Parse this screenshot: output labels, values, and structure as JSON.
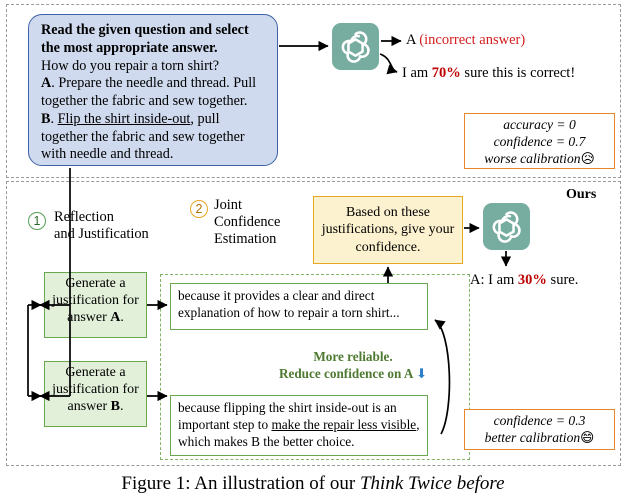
{
  "prompt": {
    "instruction": "Read the given question and select the most appropriate answer.",
    "question": "How do you repair a torn shirt?",
    "option_a_letter": "A",
    "option_a_text": ". Prepare the needle and thread. Pull together the fabric and sew together.",
    "option_b_letter": "B",
    "option_b_underlined": "Flip the shirt inside-out",
    "option_b_rest": ", pull together the fabric and sew together with needle and thread."
  },
  "baseline": {
    "answer_letter": "A",
    "answer_note": "(incorrect answer)",
    "confidence_prefix": "I am ",
    "confidence_value": "70%",
    "confidence_suffix": " sure this is correct!",
    "metrics": {
      "accuracy": "accuracy = 0",
      "confidence": "confidence = 0.7",
      "calibration": "worse calibration",
      "emoji": "sad-face-emoji",
      "emoji_glyph": "😥"
    }
  },
  "ours": {
    "panel_label": "Ours",
    "step1": {
      "number": "1",
      "label": "Reflection\nand Justification"
    },
    "step2": {
      "number": "2",
      "label": "Joint\nConfidence\nEstimation"
    },
    "generate_a": "Generate a justification for answer",
    "generate_a_letter": "A",
    "generate_b": "Generate a justification for answer",
    "generate_b_letter": "B",
    "justification_a": "because it provides a clear and direct explanation of how to repair a torn shirt...",
    "justification_b_part1": "because flipping the shirt inside-out is an important step to ",
    "justification_b_underlined": "make the repair less visible",
    "justification_b_part2": ", which makes B the better choice.",
    "reliable_line1": "More reliable.",
    "reliable_line2": "Reduce confidence on A",
    "reliable_arrow_glyph": "⬇",
    "instruction": "Based on these justifications, give your confidence.",
    "answer_prefix": "A: I am ",
    "answer_value": "30%",
    "answer_suffix": " sure.",
    "metrics": {
      "confidence": "confidence = 0.3",
      "calibration": "better calibration",
      "emoji": "grinning-face-emoji",
      "emoji_glyph": "😄"
    }
  },
  "caption": {
    "prefix": "Figure 1:  An illustration of our ",
    "italic": "Think Twice before"
  },
  "colors": {
    "prompt_fill": "#cfdaee",
    "prompt_border": "#3f62a8",
    "gpt_tile": "#76ada0",
    "orange": "#e8862a",
    "yellow_border": "#e8a727",
    "yellow_fill": "#fdf2cf",
    "green_border": "#6aa84f",
    "green_fill": "#e2efd9",
    "green_text": "#4f7a32",
    "red": "#c00000"
  }
}
